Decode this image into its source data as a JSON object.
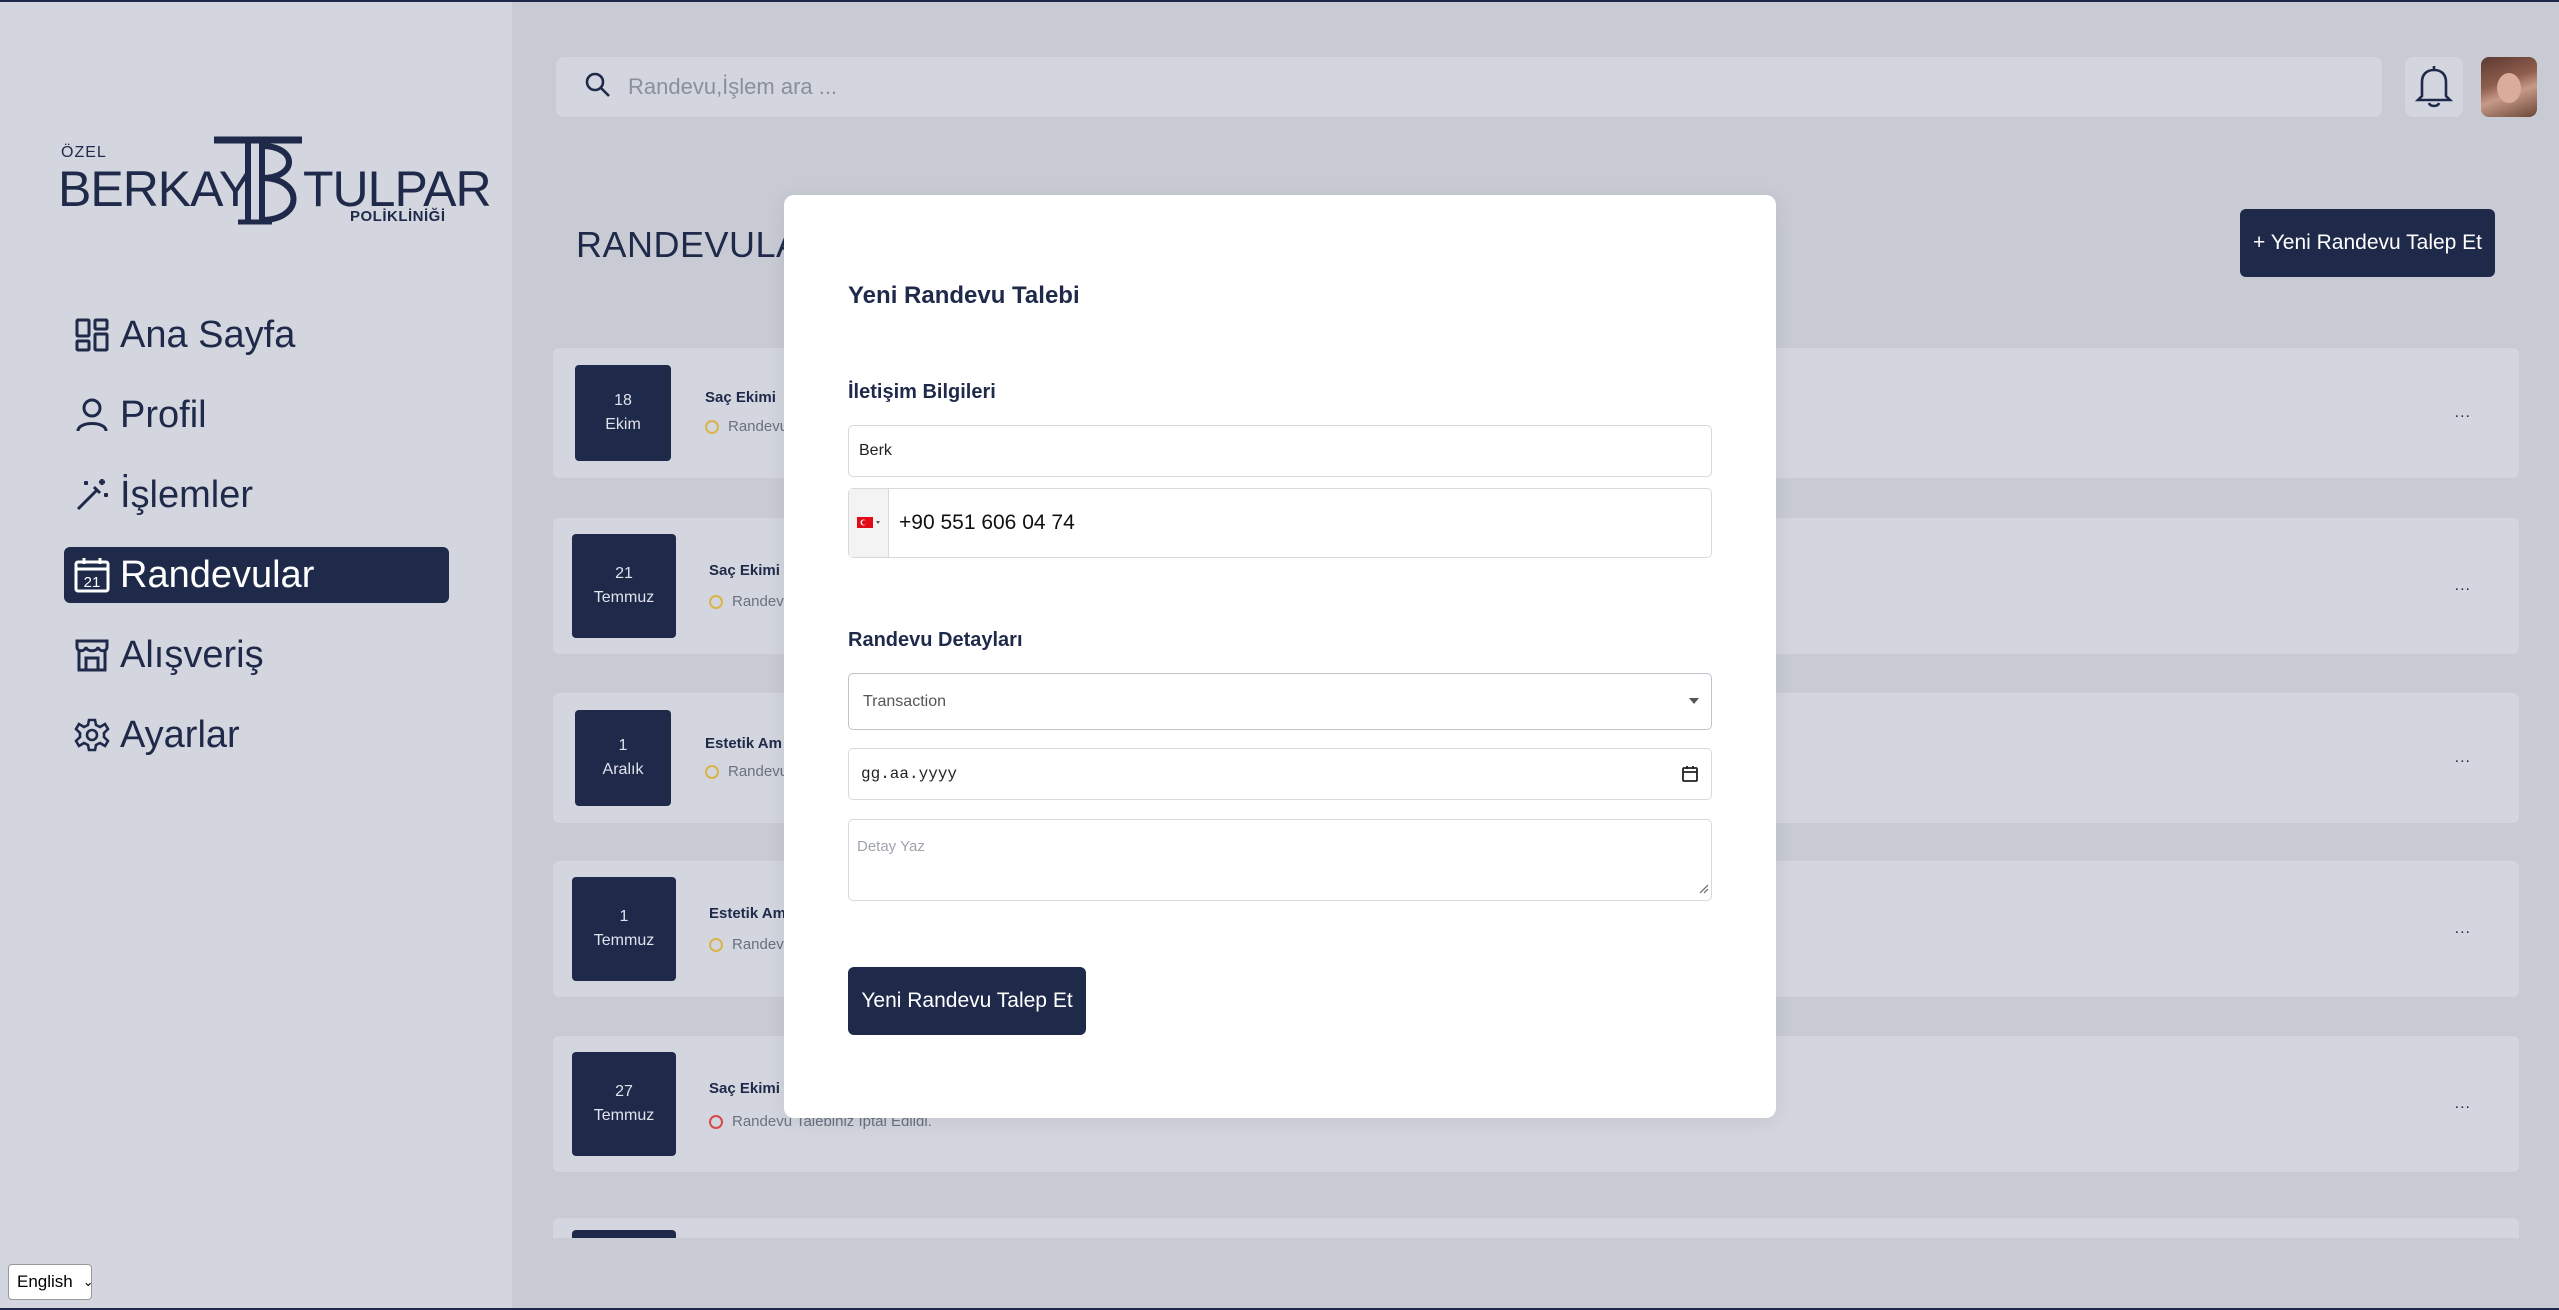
{
  "sidebar": {
    "logo": {
      "ozel": "ÖZEL",
      "berkay": "BERKAY",
      "tulpar": "TULPAR",
      "poliklinik": "POLİKLİNİĞİ"
    },
    "items": [
      {
        "label": "Ana Sayfa",
        "icon": "grid-icon",
        "active": false
      },
      {
        "label": "Profil",
        "icon": "user-icon",
        "active": false
      },
      {
        "label": "İşlemler",
        "icon": "magic-wand-icon",
        "active": false
      },
      {
        "label": "Randevular",
        "icon": "calendar-icon",
        "active": true,
        "calendar_day": "21"
      },
      {
        "label": "Alışveriş",
        "icon": "store-icon",
        "active": false
      },
      {
        "label": "Ayarlar",
        "icon": "gear-icon",
        "active": false
      }
    ],
    "language": "English"
  },
  "header": {
    "search_placeholder": "Randevu,İşlem ara ..."
  },
  "main": {
    "page_title": "RANDEVULAR",
    "new_button": "+ Yeni Randevu Talep Et",
    "appointments": [
      {
        "day": "18",
        "month": "Ekim",
        "title": "Saç Ekimi",
        "status": "Randevu",
        "status_type": "pending"
      },
      {
        "day": "21",
        "month": "Temmuz",
        "title": "Saç Ekimi",
        "status": "Randevu",
        "status_type": "pending"
      },
      {
        "day": "1",
        "month": "Aralık",
        "title": "Estetik Am",
        "status": "Randevu",
        "status_type": "pending"
      },
      {
        "day": "1",
        "month": "Temmuz",
        "title": "Estetik Am",
        "status": "Randevu",
        "status_type": "pending"
      },
      {
        "day": "27",
        "month": "Temmuz",
        "title": "Saç Ekimi",
        "status": "Randevu Talebiniz İptal Edildi.",
        "status_type": "cancelled"
      }
    ],
    "more_label": "..."
  },
  "modal": {
    "title": "Yeni Randevu Talebi",
    "contact_section": "İletişim Bilgileri",
    "name_value": "Berk",
    "phone_value": "+90 551 606 04 74",
    "details_section": "Randevu Detayları",
    "transaction_value": "Transaction",
    "date_placeholder": "gg.aa.yyyy",
    "detail_placeholder": "Detay Yaz",
    "submit_label": "Yeni Randevu Talep Et"
  },
  "colors": {
    "brand": "#1f2a4a",
    "sidebar_bg": "#d3d6de",
    "overlay_bg": "#c8cbd4",
    "pending": "#d8b44a",
    "cancelled": "#d84a4a"
  }
}
